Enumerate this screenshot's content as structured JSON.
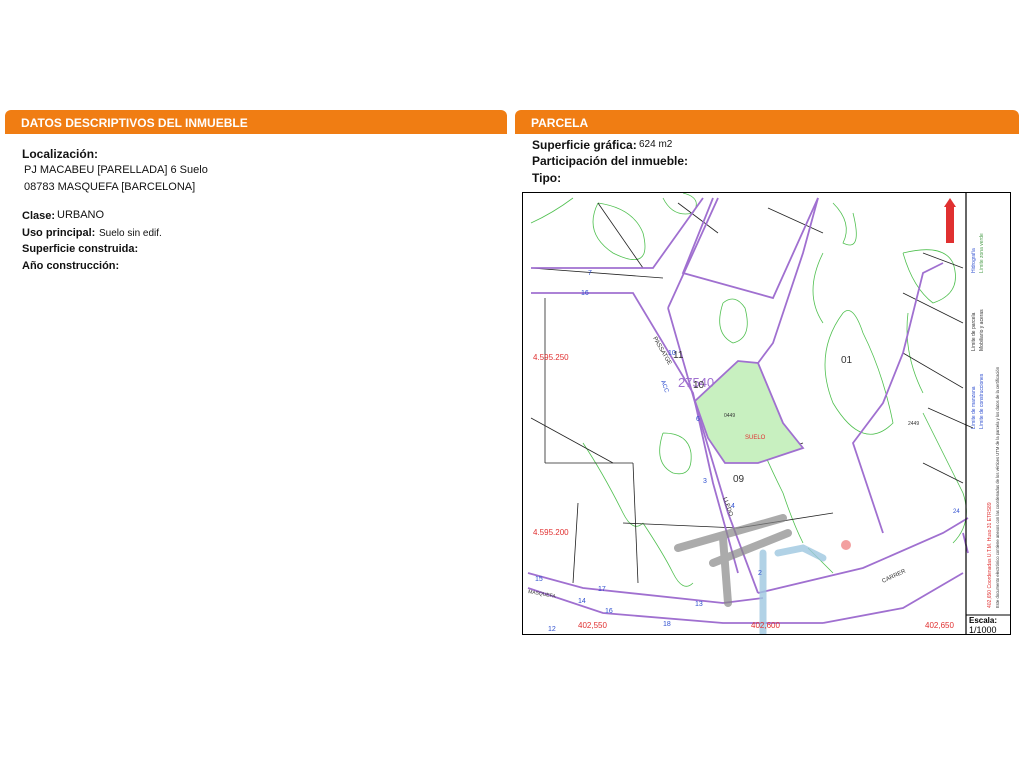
{
  "left_section": {
    "title": "DATOS DESCRIPTIVOS DEL INMUEBLE",
    "localizacion_label": "Localización:",
    "address_line1": "PJ MACABEU [PARELLADA] 6 Suelo",
    "address_line2": "08783 MASQUEFA [BARCELONA]",
    "clase_label": "Clase:",
    "clase_value": "URBANO",
    "uso_label": "Uso principal:",
    "uso_value": "Suelo sin edif.",
    "superficie_construida_label": "Superficie construida:",
    "anio_label": "Año construcción:"
  },
  "right_section": {
    "title": "PARCELA",
    "superficie_grafica_label": "Superficie gráfica:",
    "superficie_grafica_value": "624 m2",
    "participacion_label": "Participación del inmueble:",
    "tipo_label": "Tipo:"
  },
  "map": {
    "block_code": "27540",
    "parcel_10": "10",
    "parcel_09": "09",
    "parcel_01": "01",
    "parcel_11": "11",
    "parcel_code_a": "0449",
    "parcel_code_b": "0449",
    "parcel_code_c": "2449",
    "suelo_label": "SUELO",
    "street_pasaje": "PASSATGE",
    "street_lled": "LLEDO",
    "street_carrer": "CARRER",
    "street_inferior": "MASQUEFA",
    "street_num_6": "6",
    "street_num_4": "4",
    "street_num_3": "3",
    "street_num_2": "2",
    "street_num_10": "10",
    "street_num_7": "7",
    "street_num_16": "16",
    "street_num_15": "15",
    "street_num_17": "17",
    "street_num_13": "13",
    "street_num_14": "14",
    "street_num_12": "12",
    "street_num_18": "18",
    "street_num_24": "24",
    "street_acc": "ACC",
    "y_coord_1": "4.595.250",
    "y_coord_2": "4.595.200",
    "x_coord_1": "402,550",
    "x_coord_2": "402,600",
    "x_coord_3": "402,650",
    "escala_label": "Escala:",
    "escala_value": "1/1000",
    "legend_limite_manzana": "Límite de manzana",
    "legend_limite_parcela": "Límite de parcela",
    "legend_limite_construcciones": "Límite de construcciones",
    "legend_mobiliario": "Mobiliario y aceras",
    "legend_limite_zona_verde": "Límite zona verde",
    "legend_hidrografia": "Hidrografía",
    "legend_coords": "402,650 Coordenadas U.T.M. Huso 31 ETRS89",
    "legend_note": "Este documento electrónico contiene anexos con las coordenadas de los vértices UTM de la parcela y los datos de la certificación",
    "colors": {
      "parcel_fill": "#c8f0c0",
      "parcel_border": "#a070d0",
      "green_line": "#50c050",
      "coord_red": "#e03030",
      "header_orange": "#f07d13"
    }
  }
}
